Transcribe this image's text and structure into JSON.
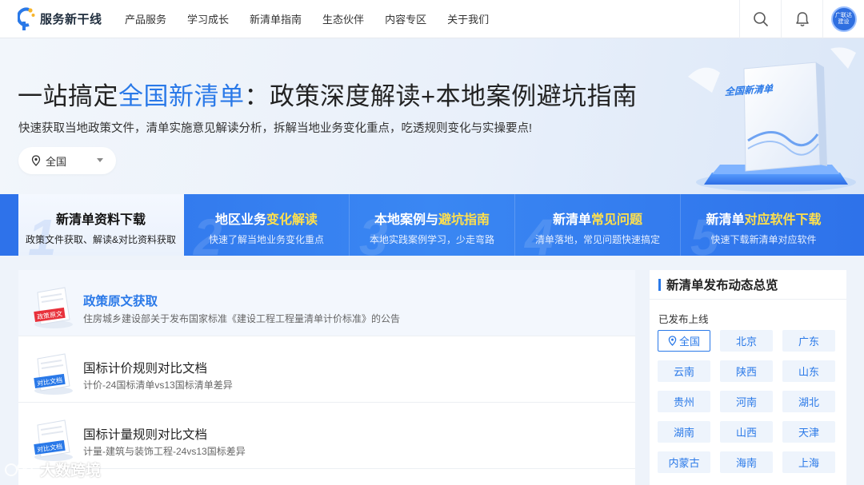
{
  "header": {
    "logo_text": "服务新干线",
    "nav": [
      "产品服务",
      "学习成长",
      "新清单指南",
      "生态伙伴",
      "内容专区",
      "关于我们"
    ],
    "avatar_text": "广联达 建设"
  },
  "hero": {
    "title_prefix": "一站搞定",
    "title_highlight": "全国新清单",
    "title_suffix": "：政策深度解读+本地案例避坑指南",
    "subtitle": "快速获取当地政策文件，清单实施意见解读分析，拆解当地业务变化重点，吃透规则变化与实操要点!",
    "region_value": "全国",
    "book_label": "全国新清单"
  },
  "tabs": [
    {
      "num": "1",
      "title_main": "新清单资料下载",
      "title_accent": "",
      "sub": "政策文件获取、解读&对比资料获取"
    },
    {
      "num": "2",
      "title_main": "地区业务",
      "title_accent": "变化解读",
      "sub": "快速了解当地业务变化重点"
    },
    {
      "num": "3",
      "title_main": "本地案例与",
      "title_accent": "避坑指南",
      "sub": "本地实践案例学习，少走弯路"
    },
    {
      "num": "4",
      "title_main": "新清单",
      "title_accent": "常见问题",
      "sub": "清单落地，常见问题快速搞定"
    },
    {
      "num": "5",
      "title_main": "新清单",
      "title_accent": "对应软件下载",
      "sub": "快速下载新清单对应软件"
    }
  ],
  "docs": [
    {
      "title": "政策原文获取",
      "desc": "住房城乡建设部关于发布国家标准《建设工程工程量清单计价标准》的公告",
      "tag": "政策原文",
      "tag_color": "#e8313b"
    },
    {
      "title": "国标计价规则对比文档",
      "desc": "计价-24国标清单vs13国标清单差异",
      "tag": "对比文档",
      "tag_color": "#2a79e8"
    },
    {
      "title": "国标计量规则对比文档",
      "desc": "计量-建筑与装饰工程-24vs13国标差异",
      "tag": "对比文档",
      "tag_color": "#2a79e8"
    }
  ],
  "sidebar": {
    "title": "新清单发布动态总览",
    "label": "已发布上线",
    "regions": [
      "全国",
      "北京",
      "广东",
      "云南",
      "陕西",
      "山东",
      "贵州",
      "河南",
      "湖北",
      "湖南",
      "山西",
      "天津",
      "内蒙古",
      "海南",
      "上海"
    ]
  },
  "watermark": "大数跨境",
  "colors": {
    "accent": "#2a79e8",
    "tab_bg": "#3a80f0",
    "tab_highlight": "#ffe04d",
    "red_tag": "#e8313b"
  }
}
